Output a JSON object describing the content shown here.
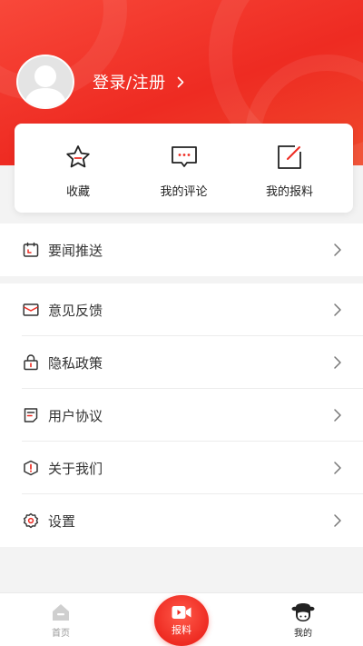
{
  "header": {
    "login_label": "登录/注册"
  },
  "quick_actions": [
    {
      "label": "收藏",
      "icon": "star-icon"
    },
    {
      "label": "我的评论",
      "icon": "comment-icon"
    },
    {
      "label": "我的报料",
      "icon": "edit-icon"
    }
  ],
  "menu": {
    "push": {
      "label": "要闻推送",
      "icon": "calendar-icon"
    },
    "feedback": {
      "label": "意见反馈",
      "icon": "mail-icon"
    },
    "privacy": {
      "label": "隐私政策",
      "icon": "lock-icon"
    },
    "agreement": {
      "label": "用户协议",
      "icon": "document-icon"
    },
    "about": {
      "label": "关于我们",
      "icon": "info-shield-icon"
    },
    "settings": {
      "label": "设置",
      "icon": "gear-icon"
    }
  },
  "tabbar": {
    "home": "首页",
    "report": "报料",
    "mine": "我的"
  },
  "colors": {
    "brand": "#EE2B22",
    "icon": "#333333"
  }
}
